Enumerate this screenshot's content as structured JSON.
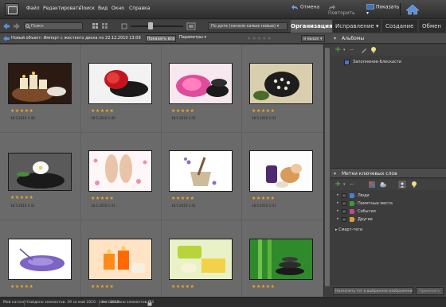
{
  "menu": {
    "items": [
      "Файл",
      "Редактировать",
      "Поиск",
      "Вид",
      "Окно",
      "Справка"
    ],
    "undo": "Отмена",
    "redo": "Повторить",
    "show": "Показать"
  },
  "toolbar": {
    "search_placeholder": "Поиск",
    "sort": "По дате (начале самые новые)"
  },
  "tabs": {
    "organize": "Организация",
    "fix": "Исправление",
    "create": "Создание",
    "share": "Обмен"
  },
  "crumb": {
    "text": "Новый объект: Импорт с жесткого диска по 22.12.2010 13:09",
    "show_all": "Показать все",
    "params": "Параметры",
    "rating_select": "и выше"
  },
  "grid": {
    "photos": [
      {
        "icon": "spa-candles-photo",
        "stars": 5,
        "date": "18.5.2010 1:40"
      },
      {
        "icon": "red-flower-stones-photo",
        "stars": 5,
        "date": "18.5.2010 1:40"
      },
      {
        "icon": "pink-orchid-stones-photo",
        "stars": 5,
        "date": "18.5.2010 1:41"
      },
      {
        "icon": "shell-stones-photo",
        "stars": 5,
        "date": "18.5.2010 1:41"
      },
      {
        "icon": "white-flower-stones-photo",
        "stars": 5,
        "date": "18.5.2010 1:41"
      },
      {
        "icon": "feet-petals-photo",
        "stars": 5,
        "date": "18.5.2010 1:41"
      },
      {
        "icon": "lavender-mortar-photo",
        "stars": 5,
        "date": "18.5.2010 1:41"
      },
      {
        "icon": "shells-bottle-photo",
        "stars": 5,
        "date": "18.5.2010 1:41"
      },
      {
        "icon": "lavender-salt-photo",
        "stars": 5,
        "date": "18.5.2010 1:41"
      },
      {
        "icon": "orange-candles-photo",
        "stars": 5,
        "date": "18.5.2010 1:41"
      },
      {
        "icon": "green-towels-photo",
        "stars": 5,
        "date": "18.5.2010 1:41"
      },
      {
        "icon": "bamboo-stones-photo",
        "stars": 5,
        "date": "18.5.2010 1:41"
      }
    ],
    "stars_glyph": "★★★★★"
  },
  "albums": {
    "title": "Альбомы",
    "item": "Заполнение-Блескасти"
  },
  "tags": {
    "title": "Метки ключевых слов",
    "items": [
      {
        "label": "Люди",
        "color": "#4a7fd6"
      },
      {
        "label": "Памятные места",
        "color": "#3c9a3c"
      },
      {
        "label": "События",
        "color": "#c44a8a"
      },
      {
        "label": "Другие",
        "color": "#d6a23a"
      }
    ],
    "smart_tags": "Смарт-теги",
    "input_placeholder": "Назначить тег в выбранное изображение",
    "apply": "Применить"
  },
  "status": {
    "mode": "Мой каталог",
    "found": "Найдено элементов: 39 за май 2010 - сент. 2010",
    "unselected": "Не показано элементов: 13"
  },
  "colors": {
    "accent": "#4a76c9",
    "star": "#f5a623"
  }
}
